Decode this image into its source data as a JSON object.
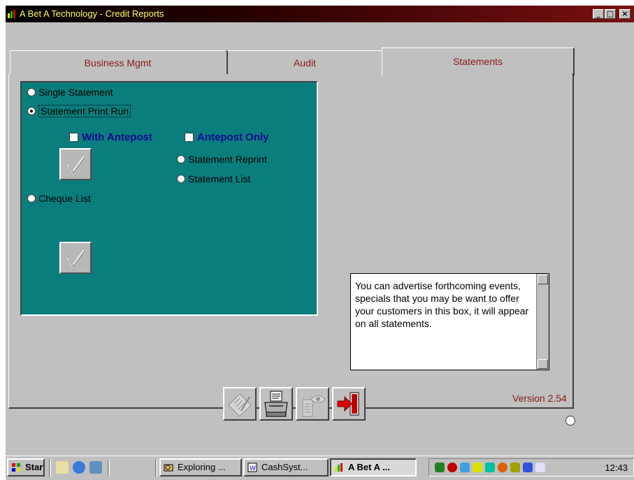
{
  "window": {
    "title": "A Bet A Technology  -  Credit Reports",
    "min": "_",
    "max": "□",
    "close": "×"
  },
  "tabs": [
    {
      "label": "Business Mgmt"
    },
    {
      "label": "Audit"
    },
    {
      "label": "Statements",
      "active": true
    }
  ],
  "statements": {
    "options": {
      "single": "Single Statement",
      "print_run": "Statement Print Run",
      "reprint": "Statement Reprint",
      "list": "Statement List",
      "cheque": "Cheque List"
    },
    "selected": "print_run",
    "checkboxes": {
      "with_antepost": "With Antepost",
      "antepost_only": "Antepost Only"
    },
    "advert_text": "You can advertise forthcoming events, specials that you may be want to offer your customers in this box, it will appear on all statements."
  },
  "footer": {
    "version": "Version 2.54"
  },
  "taskbar": {
    "start": "Start",
    "tasks": [
      "Exploring ...",
      "CashSyst...",
      "A Bet A ..."
    ],
    "clock": "12:43"
  },
  "colors": {
    "panel_green": "#0a7d7d",
    "tab_text": "#8b1a1a",
    "checkbox_text": "#0a0a90"
  }
}
